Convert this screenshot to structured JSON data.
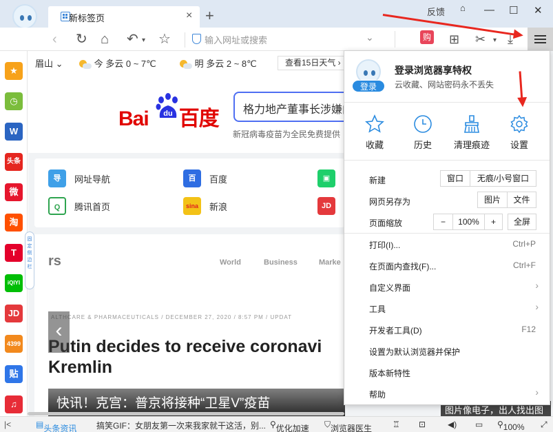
{
  "titlebar": {
    "login": "登录",
    "tab_title": "新标签页",
    "tab_close": "×",
    "new_tab": "+",
    "feedback": "反馈",
    "minimize": "—",
    "maximize": "☐",
    "close": "✕"
  },
  "toolbar": {
    "address_placeholder": "输入网址或搜索",
    "buy": "购"
  },
  "weather": {
    "city": "眉山",
    "today": "今 多云 0 ~ 7℃",
    "tomorrow": "明 多云 2 ~ 8℃",
    "fifteen_day": "查看15日天气 ›"
  },
  "search": {
    "query": "格力地产董事长涉嫌向",
    "hot": "新冠病毒疫苗为全民免费提供",
    "logo_bai": "Bai",
    "logo_du": "du",
    "logo_cn": "百度"
  },
  "links": [
    {
      "label": "网址导航",
      "icon": "导",
      "color": "#3fa0e8"
    },
    {
      "label": "百度",
      "icon": "百",
      "color": "#2e6de2"
    },
    {
      "label": "腾讯首页",
      "icon": "Q",
      "color": "#ffffff"
    },
    {
      "label": "新浪",
      "icon": "sina",
      "color": "#f3c217"
    },
    {
      "label": "",
      "icon": "▣",
      "color": "#1ecf6b"
    },
    {
      "label": "",
      "icon": "JD",
      "color": "#e4393c"
    }
  ],
  "news": {
    "rs": "rs",
    "nav": [
      "World",
      "Business",
      "Marke"
    ],
    "meta": "ALTHCARE & PHARMACEUTICALS  /  DECEMBER 27, 2020 / 8:57 PM / UPDAT",
    "head1": "Putin decides to receive coronavi",
    "head2": "Kremlin",
    "caption": "快讯！克宫：普京将接种“卫星V”疫苗",
    "right_caption": "图片像电子，出人找出图"
  },
  "sidebar_icons": [
    "★",
    "◷",
    "W",
    "头条",
    "微",
    "淘",
    "T",
    "iQIYI",
    "JD",
    "4399",
    "贴",
    "♫"
  ],
  "fold_tab": "固定侧边栏",
  "panel": {
    "login": "登录",
    "title": "登录浏览器享特权",
    "subtitle": "云收藏、网站密码永不丢失",
    "quick": [
      {
        "label": "收藏",
        "icon": "star-icon"
      },
      {
        "label": "历史",
        "icon": "clock-icon"
      },
      {
        "label": "清理痕迹",
        "icon": "broom-icon"
      },
      {
        "label": "设置",
        "icon": "gear-icon"
      }
    ],
    "menu": {
      "new": "新建",
      "new_window": "窗口",
      "new_private": "无痕/小号窗口",
      "save_as": "网页另存为",
      "save_image": "图片",
      "save_file": "文件",
      "zoom": "页面缩放",
      "zoom_minus": "−",
      "zoom_value": "100%",
      "zoom_plus": "+",
      "fullscreen": "全屏",
      "print": "打印(I)...",
      "print_sc": "Ctrl+P",
      "find": "在页面内查找(F)...",
      "find_sc": "Ctrl+F",
      "customize": "自定义界面",
      "tools": "工具",
      "devtools": "开发者工具(D)",
      "devtools_sc": "F12",
      "default": "设置为默认浏览器并保护",
      "whatsnew": "版本新特性",
      "help": "帮助"
    }
  },
  "statusbar": {
    "news": "头条资讯",
    "ticker": "搞笑GIF：女朋友第一次来我家就干这活，别...",
    "optimize": "优化加速",
    "doctor": "浏览器医生",
    "zoom": "100%"
  },
  "colors": {
    "accent": "#2a8be0",
    "arrow": "#e8271f",
    "baidu_red": "#e10601",
    "baidu_blue": "#2932e1"
  }
}
